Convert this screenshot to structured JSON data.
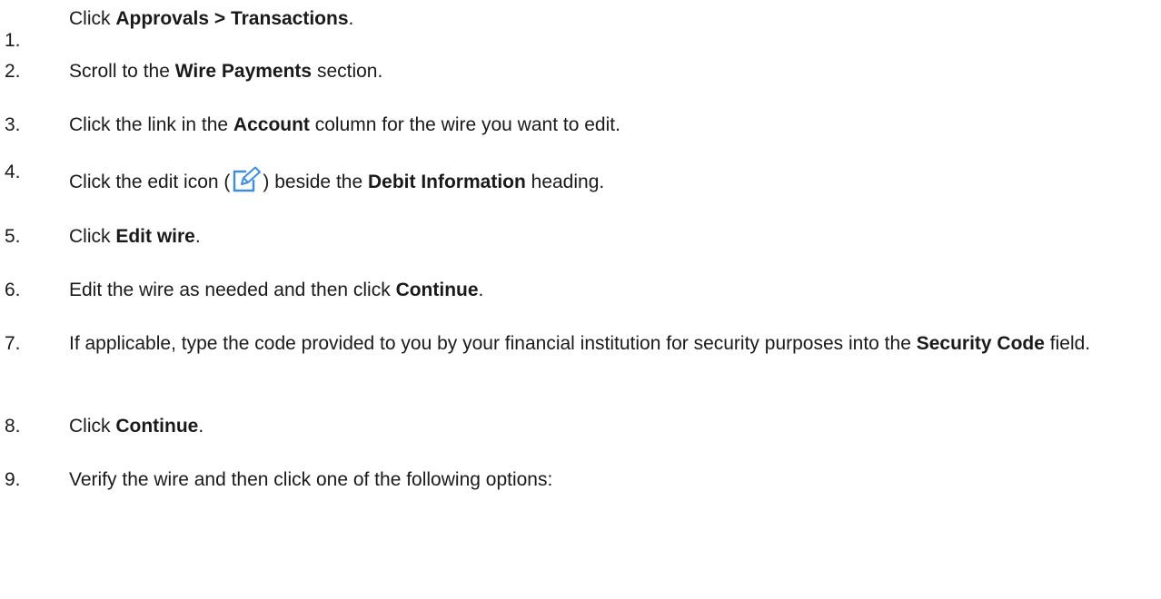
{
  "steps": [
    {
      "num": "1.",
      "parts": [
        {
          "t": "Click "
        },
        {
          "t": "Approvals  >  Transactions",
          "b": true
        },
        {
          "t": "."
        }
      ]
    },
    {
      "num": "2.",
      "parts": [
        {
          "t": "Scroll to the "
        },
        {
          "t": "Wire Payments",
          "b": true
        },
        {
          "t": " section."
        }
      ]
    },
    {
      "num": "3.",
      "parts": [
        {
          "t": "Click the link in the "
        },
        {
          "t": "Account",
          "b": true
        },
        {
          "t": " column for the wire you want to edit."
        }
      ]
    },
    {
      "num": "4.",
      "parts": [
        {
          "t": "Click the edit icon ("
        },
        {
          "icon": "edit-icon"
        },
        {
          "t": ") beside the "
        },
        {
          "t": "Debit Information",
          "b": true
        },
        {
          "t": " heading."
        }
      ]
    },
    {
      "num": "5.",
      "parts": [
        {
          "t": "Click "
        },
        {
          "t": "Edit wire",
          "b": true
        },
        {
          "t": "."
        }
      ]
    },
    {
      "num": "6.",
      "parts": [
        {
          "t": "Edit the wire as needed and then click "
        },
        {
          "t": "Continue",
          "b": true
        },
        {
          "t": "."
        }
      ]
    },
    {
      "num": "7.",
      "parts": [
        {
          "t": "If applicable, type the code provided to you by your financial institution for security purposes into the "
        },
        {
          "t": "Security Code",
          "b": true
        },
        {
          "t": " field."
        }
      ]
    },
    {
      "num": "8.",
      "parts": [
        {
          "t": "Click "
        },
        {
          "t": "Continue",
          "b": true
        },
        {
          "t": "."
        }
      ]
    },
    {
      "num": "9.",
      "parts": [
        {
          "t": "Verify the wire and then click one of the following options:"
        }
      ]
    }
  ],
  "icons": {
    "edit_icon_color": "#3a8ee6"
  }
}
